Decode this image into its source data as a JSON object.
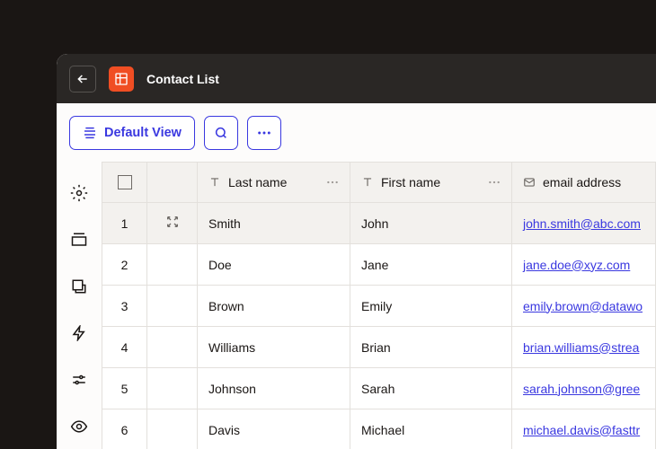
{
  "header": {
    "title": "Contact List"
  },
  "toolbar": {
    "default_view_label": "Default View"
  },
  "columns": {
    "last_name": "Last name",
    "first_name": "First name",
    "email": "email address"
  },
  "rows": [
    {
      "num": "1",
      "last": "Smith",
      "first": "John",
      "email": "john.smith@abc.com"
    },
    {
      "num": "2",
      "last": "Doe",
      "first": "Jane",
      "email": "jane.doe@xyz.com"
    },
    {
      "num": "3",
      "last": "Brown",
      "first": "Emily",
      "email": "emily.brown@datawo"
    },
    {
      "num": "4",
      "last": "Williams",
      "first": "Brian",
      "email": "brian.williams@strea"
    },
    {
      "num": "5",
      "last": "Johnson",
      "first": "Sarah",
      "email": "sarah.johnson@gree"
    },
    {
      "num": "6",
      "last": "Davis",
      "first": "Michael",
      "email": "michael.davis@fasttr"
    }
  ]
}
